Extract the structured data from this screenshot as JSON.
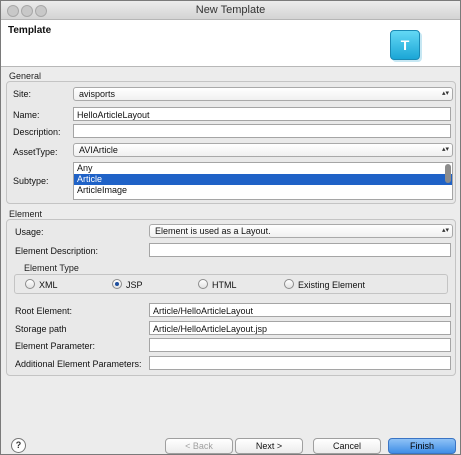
{
  "window": {
    "title": "New Template"
  },
  "header": {
    "title": "Template",
    "icon_letter": "T"
  },
  "general": {
    "group_title": "General",
    "site_label": "Site:",
    "site_value": "avisports",
    "name_label": "Name:",
    "name_value": "HelloArticleLayout",
    "description_label": "Description:",
    "description_value": "",
    "assettype_label": "AssetType:",
    "assettype_value": "AVIArticle",
    "subtype_label": "Subtype:",
    "subtypes": [
      "Any",
      "Article",
      "ArticleImage"
    ]
  },
  "element": {
    "group_title": "Element",
    "usage_label": "Usage:",
    "usage_value": "Element is used as a Layout.",
    "description_label": "Element Description:",
    "description_value": "",
    "type_title": "Element Type",
    "types": [
      "XML",
      "JSP",
      "HTML",
      "Existing Element"
    ],
    "selected_type": "JSP",
    "root_label": "Root Element:",
    "root_value": "Article/HelloArticleLayout",
    "storage_label": "Storage path",
    "storage_value": "Article/HelloArticleLayout.jsp",
    "param_label": "Element Parameter:",
    "param_value": "",
    "additional_label": "Additional Element Parameters:",
    "additional_value": ""
  },
  "buttons": {
    "help": "?",
    "back": "< Back",
    "next": "Next >",
    "cancel": "Cancel",
    "finish": "Finish"
  }
}
